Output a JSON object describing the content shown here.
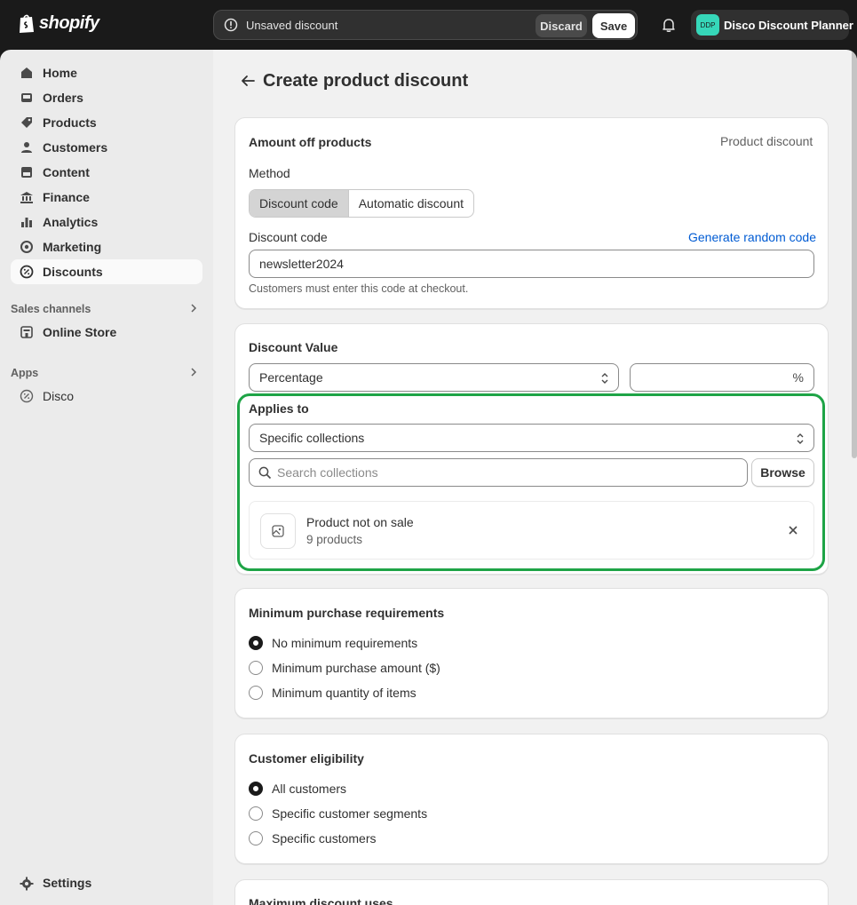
{
  "brand": {
    "wordmark": "shopify"
  },
  "topbar": {
    "unsaved_text": "Unsaved discount",
    "discard_label": "Discard",
    "save_label": "Save",
    "store_initials": "DDP",
    "store_name": "Disco Discount Planner",
    "avatar_color": "#36d7b9"
  },
  "sidebar": {
    "items": [
      {
        "label": "Home",
        "icon": "home-icon"
      },
      {
        "label": "Orders",
        "icon": "inbox-icon"
      },
      {
        "label": "Products",
        "icon": "tag-icon"
      },
      {
        "label": "Customers",
        "icon": "person-icon"
      },
      {
        "label": "Content",
        "icon": "content-icon"
      },
      {
        "label": "Finance",
        "icon": "bank-icon"
      },
      {
        "label": "Analytics",
        "icon": "bar-chart-icon"
      },
      {
        "label": "Marketing",
        "icon": "target-icon"
      },
      {
        "label": "Discounts",
        "icon": "discount-badge-icon",
        "active": true
      }
    ],
    "sales_channels_heading": "Sales channels",
    "online_store_label": "Online Store",
    "apps_heading": "Apps",
    "disco_label": "Disco",
    "settings_label": "Settings"
  },
  "page": {
    "title": "Create product discount"
  },
  "amount_card": {
    "title": "Amount off products",
    "type_label": "Product discount",
    "method_label": "Method",
    "method_options": [
      "Discount code",
      "Automatic discount"
    ],
    "method_selected": "Discount code",
    "code_label": "Discount code",
    "generate_link": "Generate random code",
    "code_value": "newsletter2024",
    "code_help": "Customers must enter this code at checkout."
  },
  "value_card": {
    "title": "Discount Value",
    "value_type": "Percentage",
    "value_amount": "",
    "value_suffix": "%",
    "applies_to_label": "Applies to",
    "applies_to_value": "Specific collections",
    "search_placeholder": "Search collections",
    "browse_label": "Browse",
    "collection_name": "Product not on sale",
    "collection_count": "9 products",
    "highlight_color": "#1ea446"
  },
  "min_card": {
    "title": "Minimum purchase requirements",
    "options": [
      "No minimum requirements",
      "Minimum purchase amount ($)",
      "Minimum quantity of items"
    ],
    "selected_index": 0
  },
  "eligibility_card": {
    "title": "Customer eligibility",
    "options": [
      "All customers",
      "Specific customer segments",
      "Specific customers"
    ],
    "selected_index": 0
  },
  "max_card": {
    "title": "Maximum discount uses"
  }
}
